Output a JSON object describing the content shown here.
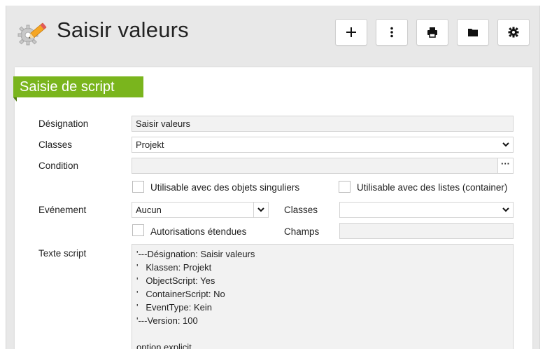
{
  "header": {
    "title": "Saisir valeurs",
    "icon": "pencil-gear-icon",
    "toolbar": [
      {
        "name": "add-button",
        "icon": "plus-icon"
      },
      {
        "name": "more-button",
        "icon": "vertical-dots-icon"
      },
      {
        "name": "print-button",
        "icon": "printer-icon"
      },
      {
        "name": "folder-button",
        "icon": "folder-icon"
      },
      {
        "name": "settings-button",
        "icon": "gear-icon"
      }
    ]
  },
  "section": {
    "title": "Saisie de script",
    "color": "#7ab51d"
  },
  "form": {
    "designation_label": "Désignation",
    "designation_value": "Saisir valeurs",
    "classes_label": "Classes",
    "classes_value": "Projekt",
    "condition_label": "Condition",
    "condition_value": "",
    "condition_button": "···",
    "single_objects_label": "Utilisable avec des objets singuliers",
    "lists_label": "Utilisable avec des listes (container)",
    "event_label": "Evénement",
    "event_value": "Aucun",
    "event_classes_label": "Classes",
    "event_classes_value": "",
    "extended_auth_label": "Autorisations étendues",
    "fields_label": "Champs",
    "fields_value": "",
    "script_label": "Texte script",
    "script_lines": [
      "'---Désignation: Saisir valeurs",
      "'   Klassen: Projekt",
      "'   ObjectScript: Yes",
      "'   ContainerScript: No",
      "'   EventType: Kein",
      "'---Version: 100",
      "",
      "option explicit"
    ]
  }
}
